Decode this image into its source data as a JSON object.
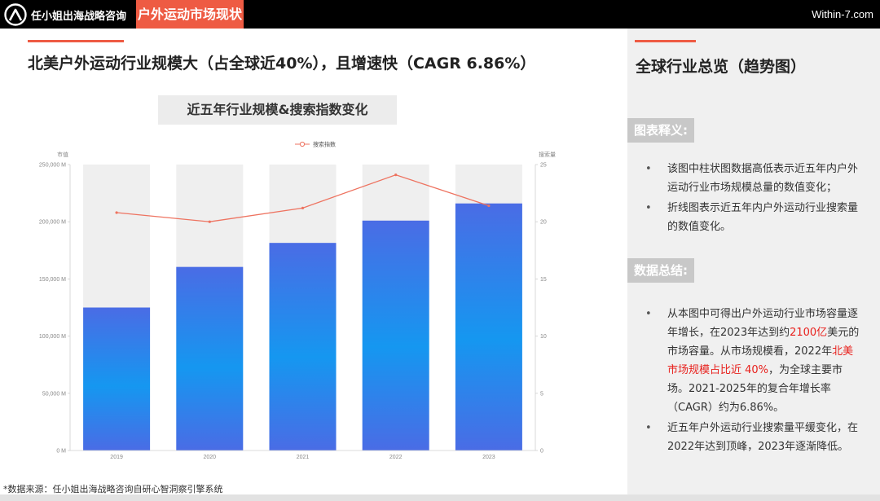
{
  "header": {
    "brand": "任小姐出海战略咨询",
    "section": "户外运动市场现状",
    "site": "Within-7.com"
  },
  "main": {
    "title": "北美户外运动行业规模大（占全球近40%），且增速快（CAGR 6.86%）",
    "chart_heading": "近五年行业规模&搜索指数变化",
    "source": "*数据来源：任小姐出海战略咨询自研心智洞察引擎系统"
  },
  "right": {
    "title": "全球行业总览（趋势图）",
    "tag1": "图表释义:",
    "desc_items": [
      "该图中柱状图数据高低表示近五年内户外运动行业市场规模总量的数值变化；",
      "折线图表示近五年内户外运动行业搜索量的数值变化。"
    ],
    "tag2": "数据总结:",
    "summary1": {
      "a": "从本图中可得出户外运动行业市场容量逐年增长，在2023年达到约",
      "b": "2100亿",
      "c": "美元的市场容量。从市场规模看，2022年",
      "d": "北美市场规模占比近 40%",
      "e": "，为全球主要市场。2021-2025年的复合年增长率（CAGR）约为6.86%。"
    },
    "summary2": "近五年户外运动行业搜索量平缓变化，在2022年达到顶峰，2023年逐渐降低。"
  },
  "chart_data": {
    "type": "bar",
    "categories": [
      "2019",
      "2020",
      "2021",
      "2022",
      "2023"
    ],
    "series": [
      {
        "values": [
          125000,
          160500,
          181500,
          201000,
          216000
        ]
      },
      {
        "name": "搜索指数",
        "values": [
          20.8,
          20.0,
          21.2,
          24.1,
          21.4
        ]
      }
    ],
    "ylabel": "市值",
    "y2label": "搜索量",
    "ylim": [
      0,
      250000
    ],
    "y2lim": [
      0,
      25
    ],
    "yticks": [
      "0 M",
      "50,000 M",
      "100,000 M",
      "150,000 M",
      "200,000 M",
      "250,000 M"
    ],
    "y2ticks": [
      "0",
      "5",
      "10",
      "15",
      "20",
      "25"
    ],
    "legend": "top-center",
    "colors": {
      "bar_top": "#4a6ce5",
      "bar_mid": "#1597f0",
      "bar_bottom": "#4a6ce5",
      "band": "#efefef",
      "line": "#ee7360"
    }
  }
}
